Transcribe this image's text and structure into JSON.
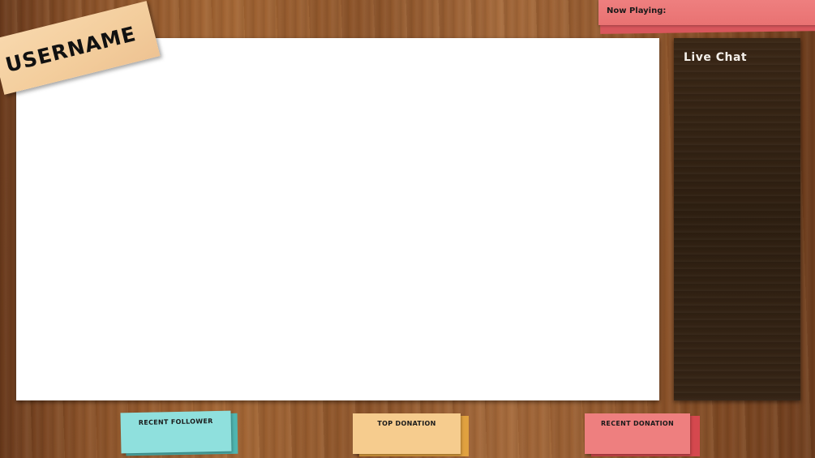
{
  "header": {
    "username": "USERNAME",
    "now_playing_label": "Now Playing:"
  },
  "chat": {
    "title": "Live Chat"
  },
  "footer": {
    "recent_follower_label": "RECENT FOLLOWER",
    "top_donation_label": "TOP DONATION",
    "recent_donation_label": "RECENT DONATION"
  },
  "colors": {
    "username_note": "#f6d3a5",
    "now_playing_note": "#ee7f7f",
    "chat_panel": "#33231a",
    "follower_note": "#8fe0dd",
    "top_donation_note": "#f6cc8e",
    "recent_donation_note": "#ee7f7f",
    "video_area": "#ffffff"
  }
}
